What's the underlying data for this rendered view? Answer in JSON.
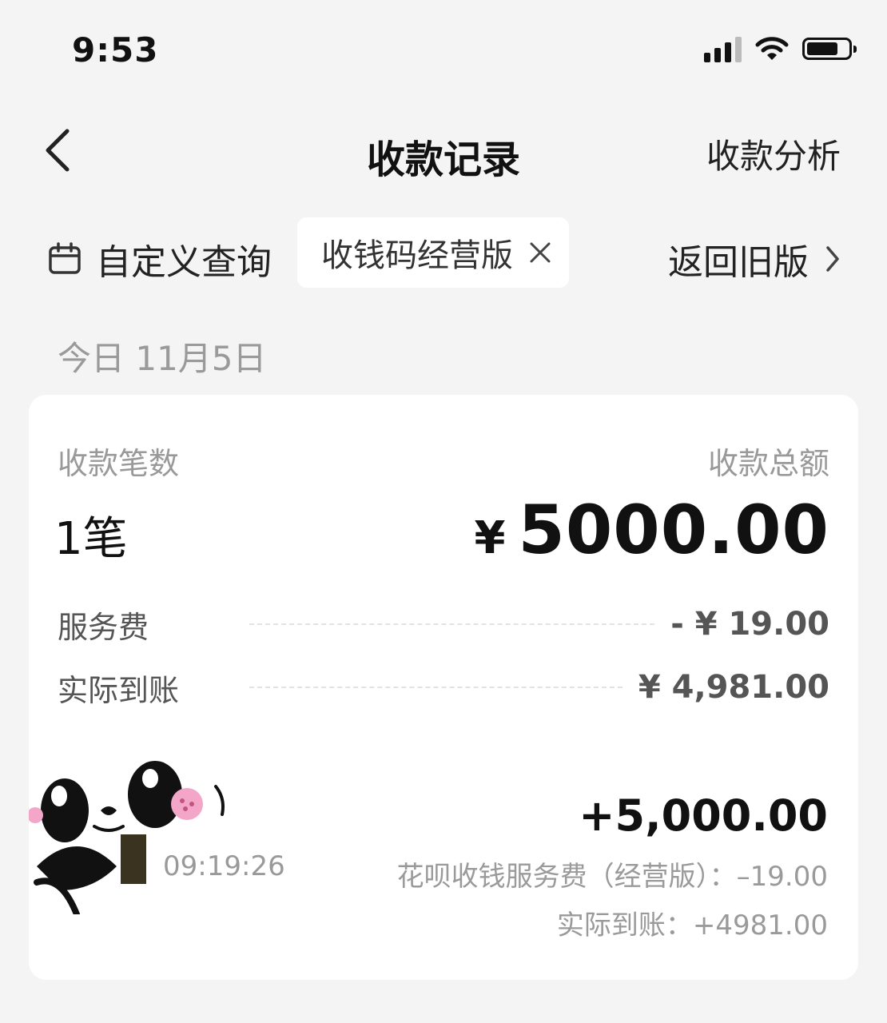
{
  "status_bar": {
    "time": "9:53",
    "icons": [
      "cellular-signal-icon",
      "wifi-icon",
      "battery-icon"
    ]
  },
  "nav": {
    "back_icon": "chevron-left-icon",
    "title": "收款记录",
    "right_action": "收款分析"
  },
  "filters": {
    "custom_query_icon": "calendar-icon",
    "custom_query_label": "自定义查询",
    "active_chip": {
      "label": "收钱码经营版",
      "close_icon": "close-icon"
    },
    "return_old_label": "返回旧版",
    "return_old_icon": "chevron-right-icon"
  },
  "date_section": {
    "label": "今日 11月5日"
  },
  "summary": {
    "count_label": "收款笔数",
    "count_value": "1笔",
    "total_label": "收款总额",
    "total_currency": "¥",
    "total_amount": "5000.00",
    "fee_label": "服务费",
    "fee_value": "- ¥ 19.00",
    "net_label": "实际到账",
    "net_value": "¥ 4,981.00"
  },
  "transactions": [
    {
      "avatar_icon": "panda-sticker-icon",
      "time": "09:19:26",
      "amount": "+5,000.00",
      "fee_text": "花呗收钱服务费（经营版）：–19.00",
      "net_text": "实际到账：+4981.00"
    }
  ],
  "colors": {
    "background": "#f4f4f4",
    "card": "#ffffff",
    "primary_text": "#111111",
    "muted_text": "#999999"
  }
}
